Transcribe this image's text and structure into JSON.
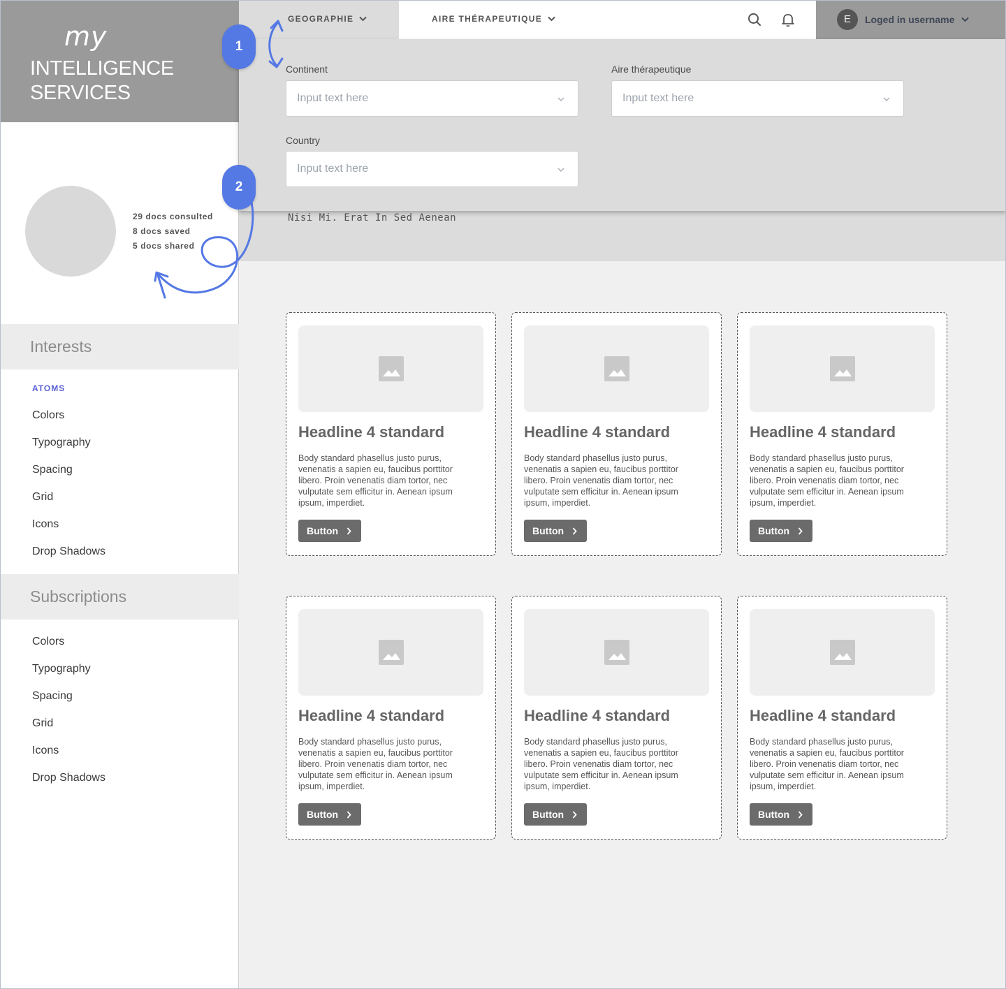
{
  "logo": {
    "my": "my",
    "line1": "INTELLIGENCE",
    "line2": "SERVICES"
  },
  "profile": {
    "stats": [
      "29 docs consulted",
      "8 docs saved",
      "5 docs shared"
    ]
  },
  "sidebar": {
    "interests_title": "Interests",
    "atoms_label": "ATOMS",
    "interests_items": [
      "Colors",
      "Typography",
      "Spacing",
      "Grid",
      "Icons",
      "Drop Shadows"
    ],
    "subscriptions_title": "Subscriptions",
    "subscriptions_items": [
      "Colors",
      "Typography",
      "Spacing",
      "Grid",
      "Icons",
      "Drop Shadows"
    ]
  },
  "topbar": {
    "tab_geographie": "GEOGRAPHIE",
    "tab_aire": "AIRE THÉRAPEUTIQUE",
    "user_initial": "E",
    "user_name": "Loged in username",
    "search_icon": "search-icon",
    "bell_icon": "bell-icon"
  },
  "filters": {
    "continent_label": "Continent",
    "continent_placeholder": "Input text here",
    "aire_label": "Aire thérapeutique",
    "aire_placeholder": "Input text here",
    "country_label": "Country",
    "country_placeholder": "Input text here"
  },
  "hero": {
    "text": "Nisi Mi. Erat In Sed Aenean"
  },
  "cards": [
    {
      "title": "Headline 4 standard",
      "body": "Body standard phasellus justo purus, venenatis a sapien eu, faucibus porttitor libero. Proin venenatis diam tortor, nec vulputate sem efficitur in. Aenean ipsum ipsum, imperdiet.",
      "button": "Button"
    },
    {
      "title": "Headline 4 standard",
      "body": "Body standard phasellus justo purus, venenatis a sapien eu, faucibus porttitor libero. Proin venenatis diam tortor, nec vulputate sem efficitur in. Aenean ipsum ipsum, imperdiet.",
      "button": "Button"
    },
    {
      "title": "Headline 4 standard",
      "body": "Body standard phasellus justo purus, venenatis a sapien eu, faucibus porttitor libero. Proin venenatis diam tortor, nec vulputate sem efficitur in. Aenean ipsum ipsum, imperdiet.",
      "button": "Button"
    },
    {
      "title": "Headline 4 standard",
      "body": "Body standard phasellus justo purus, venenatis a sapien eu, faucibus porttitor libero. Proin venenatis diam tortor, nec vulputate sem efficitur in. Aenean ipsum ipsum, imperdiet.",
      "button": "Button"
    },
    {
      "title": "Headline 4 standard",
      "body": "Body standard phasellus justo purus, venenatis a sapien eu, faucibus porttitor libero. Proin venenatis diam tortor, nec vulputate sem efficitur in. Aenean ipsum ipsum, imperdiet.",
      "button": "Button"
    },
    {
      "title": "Headline 4 standard",
      "body": "Body standard phasellus justo purus, venenatis a sapien eu, faucibus porttitor libero. Proin venenatis diam tortor, nec vulputate sem efficitur in. Aenean ipsum ipsum, imperdiet.",
      "button": "Button"
    }
  ],
  "annotations": {
    "badge1": "1",
    "badge2": "2"
  },
  "colors": {
    "accent": "#5478e4",
    "atoms": "#5a5fd6",
    "button": "#6b6b6b",
    "panel": "#dcdcdc"
  }
}
